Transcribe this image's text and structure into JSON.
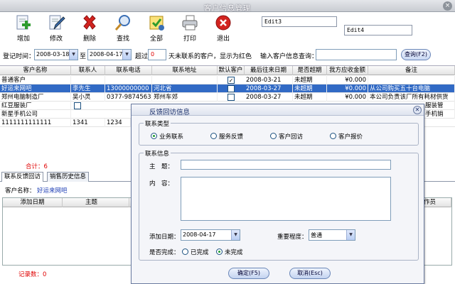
{
  "window": {
    "title": "客户信息管理",
    "close": "×"
  },
  "toolbar": {
    "buttons": [
      {
        "label": "增加",
        "icon": "add-icon",
        "color": "#2e9b2e"
      },
      {
        "label": "修改",
        "icon": "edit-icon",
        "color": "#3a6fb5"
      },
      {
        "label": "删除",
        "icon": "delete-icon",
        "color": "#d2231f"
      },
      {
        "label": "查找",
        "icon": "search-icon",
        "color": "#3a6fb5"
      },
      {
        "label": "全部",
        "icon": "all-icon",
        "color": "#d9a21b"
      },
      {
        "label": "打印",
        "icon": "print-icon",
        "color": "#555"
      },
      {
        "label": "退出",
        "icon": "exit-icon",
        "color": "#d2231f"
      }
    ],
    "edit3": "Edit3",
    "edit4": "Edit4"
  },
  "filter": {
    "reg_time_label": "登记时间：",
    "date_from": "2008-03-18",
    "to_label": "至",
    "date_to": "2008-04-17",
    "exceed_label": "超过",
    "days_value": "0",
    "days_suffix": "天未联系的客户，显示为红色",
    "query_label": "输入客户信息查询：",
    "query_value": "",
    "query_button": "查询(F2)"
  },
  "table": {
    "columns": [
      "客户名称",
      "联系人",
      "联系电话",
      "联系地址",
      "默认客户",
      "最后往来日期",
      "是否超期",
      "我方应收金额",
      "备注"
    ],
    "rows": [
      {
        "name": "普通客户",
        "contact": "",
        "phone": "",
        "address": "",
        "default": true,
        "last_date": "2008-03-21",
        "overdue": "未超期",
        "amount": "¥0.000",
        "note": "",
        "selected": false
      },
      {
        "name": "好运来网吧",
        "contact": "李先生",
        "phone": "13000000000",
        "address": "河北省",
        "default": false,
        "last_date": "2008-03-27",
        "overdue": "未超期",
        "amount": "¥0.000",
        "note": "从公司购买五十台电脑",
        "selected": true
      },
      {
        "name": "郑州电脑制造厂",
        "contact": "吴小灵",
        "phone": "0377-987456321",
        "address": "郑州车郊",
        "default": false,
        "last_date": "2008-03-27",
        "overdue": "未超期",
        "amount": "¥0.000",
        "note": "本公司负责该厂所有耗材供货",
        "selected": false
      },
      {
        "name": "红豆服装厂",
        "contact": "",
        "phone": "",
        "address": "",
        "default": false,
        "last_date": "",
        "overdue": "",
        "amount": "",
        "note": "服装管",
        "selected": false
      },
      {
        "name": "新星手机公司",
        "contact": "",
        "phone": "",
        "address": "",
        "default": false,
        "last_date": "",
        "overdue": "",
        "amount": "",
        "note": "手机销",
        "selected": false
      },
      {
        "name": "1111111111111",
        "contact": "1341",
        "phone": "1234",
        "address": "",
        "default": false,
        "last_date": "",
        "overdue": "",
        "amount": "",
        "note": "",
        "selected": false
      }
    ],
    "total": "合计：6"
  },
  "tabs": [
    "联系反馈回访",
    "销售历史信息"
  ],
  "lower": {
    "customer_label": "客户名称：",
    "customer_name": "好运来网吧",
    "columns": [
      "添加日期",
      "主题",
      "作员"
    ],
    "records": "记录数：0"
  },
  "dialog": {
    "title": "反馈回访信息",
    "type_group": "联系类型",
    "types": [
      {
        "label": "业务联系",
        "checked": true
      },
      {
        "label": "服务反馈",
        "checked": false
      },
      {
        "label": "客户回访",
        "checked": false
      },
      {
        "label": "客户报价",
        "checked": false
      }
    ],
    "info_group": "联系信息",
    "subject_label": "主　题：",
    "subject_value": "",
    "content_label": "内　容：",
    "content_value": "",
    "add_date_label": "添加日期：",
    "add_date": "2008-04-17",
    "importance_label": "重要程度：",
    "importance": "普通",
    "done_label": "是否完成：",
    "done_options": [
      {
        "label": "已完成",
        "checked": false
      },
      {
        "label": "未完成",
        "checked": true
      }
    ],
    "ok_button": "确定(F5)",
    "cancel_button": "取消(Esc)"
  }
}
